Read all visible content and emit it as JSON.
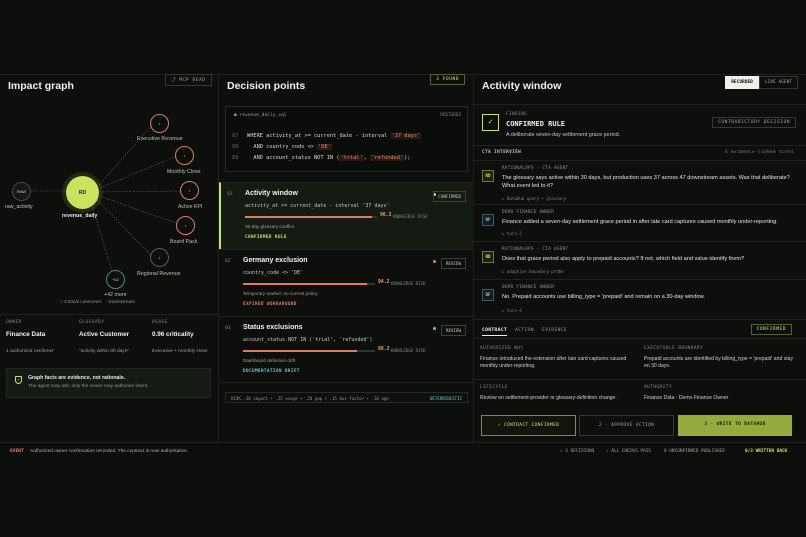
{
  "impact": {
    "title": "Impact graph",
    "badge": "MCP READ",
    "nodes": {
      "raw": {
        "short": "RAW",
        "label": "raw_activity"
      },
      "center": {
        "short": "RD",
        "label": "revenue_daily"
      },
      "exec": "Executive Revenue",
      "monthly": "Monthly Close",
      "kpi": "Active KPI",
      "board": "Board Pack",
      "regional": "Regional Revenue",
      "more_short": "+42",
      "more": "+42 more"
    },
    "legend": {
      "critical": "Critical consumer",
      "downstream": "Downstream"
    },
    "owner": {
      "key": "OWNER",
      "value": "Finance Data",
      "desc": "1 authorized confirmer"
    },
    "glossary": {
      "key": "GLOSSARY",
      "value": "Active Customer",
      "desc": "\"activity within 30 days\""
    },
    "usage": {
      "key": "USAGE",
      "value": "0.96 criticality",
      "desc": "Executive + monthly close"
    },
    "note": {
      "title": "Graph facts are evidence, not rationale.",
      "sub": "The agent may ask; only the owner may authorize intent."
    }
  },
  "decision": {
    "title": "Decision points",
    "found": "3 FOUND",
    "file": "revenue_daily.sql",
    "engine": "POSTGRES",
    "lines": [
      {
        "n": "87",
        "pre": "WHERE activity_at >= current_date - interval ",
        "hl": "'37 days'",
        "post": ""
      },
      {
        "n": "88",
        "pre": "  AND country_code <> ",
        "hl": "'DE'",
        "post": ""
      },
      {
        "n": "89",
        "pre": "  AND account_status NOT IN (",
        "hl": "'trial'",
        "mid": ", ",
        "hl2": "'refunded'",
        "post": ");"
      }
    ],
    "points": [
      {
        "num": "01",
        "title": "Activity window",
        "code": "activity_at >= current_date - interval '37 days'",
        "risk": 96.2,
        "risk_label": "96.2",
        "risk_key": "KNOWLEDGE RISK",
        "sub": "30-day glossary conflict",
        "status": "CONFIRMED RULE",
        "tag": "CONFIRMED"
      },
      {
        "num": "02",
        "title": "Germany exclusion",
        "code": "country_code <> 'DE'",
        "risk": 94.2,
        "risk_label": "94.2",
        "risk_key": "KNOWLEDGE RISK",
        "sub": "Temporary marker, no current policy",
        "status": "EXPIRED WORKAROUND",
        "tag": "REVIEW"
      },
      {
        "num": "03",
        "title": "Status exclusions",
        "code": "account_status NOT IN ('trial', 'refunded')",
        "risk": 86.2,
        "risk_label": "86.2",
        "risk_key": "KNOWLEDGE RISK",
        "sub": "Dashboard definition drift",
        "status": "DOCUMENTATION DRIFT",
        "tag": "REVIEW"
      }
    ],
    "formula": "RISK .30 impact + .25 usage + .20 gap + .15 bus factor + .10 age",
    "formula_tag": "DETERMINISTIC"
  },
  "activity": {
    "title": "Activity window",
    "tab_recorded": "RECORDED",
    "tab_live": "LIVE AGENT",
    "finding_key": "FINDING",
    "finding_title": "CONFIRMED RULE",
    "finding_desc": "A deliberate seven-day settlement grace period.",
    "contradictory": "CONTRADICTORY DECISION",
    "interview": "CTA INTERVIEW",
    "turns": "4 evidence-linked turns",
    "messages": [
      {
        "av": "RD",
        "who": "RATIONALOPS · CTA AGENT",
        "text": "The glossary says active within 30 days, but production uses 37 across 47 downstream assets. Was that deliberate? What event led to it?",
        "trace": "↳ DataHub query + glossary"
      },
      {
        "av": "DF",
        "who": "DEMO FINANCE OWNER",
        "text": "Finance added a seven-day settlement grace period in after late card captures caused monthly under-reporting.",
        "trace": "↳ turn-2"
      },
      {
        "av": "RD",
        "who": "RATIONALOPS · CTA AGENT",
        "text": "Does that grace period also apply to prepaid accounts? If not, which field and value identify them?",
        "trace": "↳ adaptive boundary probe"
      },
      {
        "av": "DF",
        "who": "DEMO FINANCE OWNER",
        "text": "No. Prepaid accounts use billing_type = 'prepaid' and remain on a 30-day window.",
        "trace": "↳ turn-4"
      }
    ],
    "contract_tabs": [
      "CONTRACT",
      "ACTION",
      "EVIDENCE"
    ],
    "confirmed": "CONFIRMED",
    "authorized_why": {
      "k": "AUTHORIZED WHY",
      "v": "Finance introduced the extension after late card captures caused monthly under-reporting."
    },
    "boundary": {
      "k": "EXECUTABLE BOUNDARY",
      "v": "Prepaid accounts are identified by billing_type = 'prepaid' and stay on 30 days."
    },
    "lifecycle": {
      "k": "LIFECYCLE",
      "v": "Review on settlement-provider or glossary-definition change."
    },
    "authority": {
      "k": "AUTHORITY",
      "v": "Finance Data · Demo Finance Owner"
    },
    "buttons": [
      "✓  CONTRACT CONFIRMED",
      "2 · APPROVE ACTION",
      "3 · WRITE TO DATAHUB"
    ]
  },
  "footer": {
    "event": "EVENT",
    "msg": "Authorized owner confirmation recorded. The contract is now authoritative.",
    "s1": "✓ 3 DECISIONS",
    "s2": "✓ ALL CHECKS PASS",
    "s3": "0 UNCONFIRMED PUBLISHED",
    "s4": "0/3 WRITTEN BACK"
  },
  "colors": {
    "accent": "#c8e35c",
    "risk": "#e07c5c",
    "owner": "#9bc6d6"
  }
}
